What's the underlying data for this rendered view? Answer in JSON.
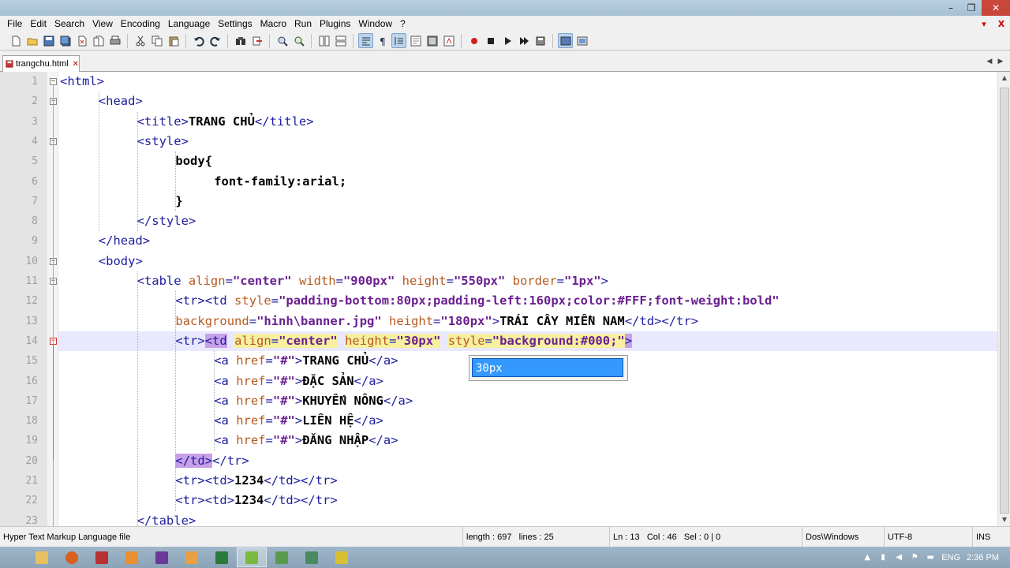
{
  "menu": [
    "File",
    "Edit",
    "Search",
    "View",
    "Encoding",
    "Language",
    "Settings",
    "Macro",
    "Run",
    "Plugins",
    "Window",
    "?"
  ],
  "menu_right": {
    "minimize": "▾",
    "close": "X"
  },
  "window_controls": {
    "minimize": "–",
    "restore": "❐",
    "close": "✕"
  },
  "tab": {
    "label": "trangchu.html",
    "close": "✕"
  },
  "line_numbers": [
    "1",
    "2",
    "3",
    "4",
    "5",
    "6",
    "7",
    "8",
    "9",
    "10",
    "11",
    "12",
    "13",
    "14",
    "15",
    "16",
    "17",
    "18",
    "19",
    "20",
    "21",
    "22",
    "23"
  ],
  "code": [
    {
      "segments": [
        {
          "c": "t",
          "s": "<html>"
        }
      ]
    },
    {
      "segments": [
        {
          "c": "t",
          "s": "<head>"
        }
      ]
    },
    {
      "segments": [
        {
          "c": "t",
          "s": "<title>"
        },
        {
          "c": "x",
          "s": "TRANG CHỦ"
        },
        {
          "c": "t",
          "s": "</title>"
        }
      ]
    },
    {
      "segments": [
        {
          "c": "t",
          "s": "<style>"
        }
      ]
    },
    {
      "segments": [
        {
          "c": "x",
          "s": "body{"
        }
      ]
    },
    {
      "segments": [
        {
          "c": "x",
          "s": "font-family:arial;"
        }
      ]
    },
    {
      "segments": [
        {
          "c": "x",
          "s": "}"
        }
      ]
    },
    {
      "segments": [
        {
          "c": "t",
          "s": "</style>"
        }
      ]
    },
    {
      "segments": [
        {
          "c": "t",
          "s": "</head>"
        }
      ]
    },
    {
      "segments": [
        {
          "c": "t",
          "s": "<body>"
        }
      ]
    },
    {
      "segments": [
        {
          "c": "t",
          "s": "<table "
        },
        {
          "c": "a",
          "s": "align"
        },
        {
          "c": "t",
          "s": "="
        },
        {
          "c": "v",
          "s": "\"center\""
        },
        {
          "c": "t",
          "s": " "
        },
        {
          "c": "a",
          "s": "width"
        },
        {
          "c": "t",
          "s": "="
        },
        {
          "c": "v",
          "s": "\"900px\""
        },
        {
          "c": "t",
          "s": " "
        },
        {
          "c": "a",
          "s": "height"
        },
        {
          "c": "t",
          "s": "="
        },
        {
          "c": "v",
          "s": "\"550px\""
        },
        {
          "c": "t",
          "s": " "
        },
        {
          "c": "a",
          "s": "border"
        },
        {
          "c": "t",
          "s": "="
        },
        {
          "c": "v",
          "s": "\"1px\""
        },
        {
          "c": "t",
          "s": ">"
        }
      ]
    },
    {
      "segments": [
        {
          "c": "t",
          "s": "<tr><td "
        },
        {
          "c": "a",
          "s": "style"
        },
        {
          "c": "t",
          "s": "="
        },
        {
          "c": "v",
          "s": "\"padding-bottom:80px;padding-left:160px;color:#FFF;font-weight:bold\""
        }
      ]
    },
    {
      "segments": [
        {
          "c": "a",
          "s": "background"
        },
        {
          "c": "t",
          "s": "="
        },
        {
          "c": "v",
          "s": "\"hinh\\banner.jpg\""
        },
        {
          "c": "t",
          "s": " "
        },
        {
          "c": "a",
          "s": "height"
        },
        {
          "c": "t",
          "s": "="
        },
        {
          "c": "v",
          "s": "\"180px\""
        },
        {
          "c": "t",
          "s": ">"
        },
        {
          "c": "x",
          "s": "TRÁI CÂY MIỀN NAM"
        },
        {
          "c": "t",
          "s": "</td></tr>"
        }
      ]
    },
    {
      "segments": [
        {
          "c": "t",
          "s": "<tr>"
        },
        {
          "c": "t hl-tag",
          "s": "<td"
        },
        {
          "c": "t",
          "s": " "
        },
        {
          "c": "a hl-attr",
          "s": "align"
        },
        {
          "c": "t hl-attr",
          "s": "="
        },
        {
          "c": "v hl-attr",
          "s": "\"center\""
        },
        {
          "c": "t",
          "s": " "
        },
        {
          "c": "a hl-attr",
          "s": "height"
        },
        {
          "c": "t hl-attr",
          "s": "="
        },
        {
          "c": "v hl-attr",
          "s": "\"30px\""
        },
        {
          "c": "t",
          "s": " "
        },
        {
          "c": "a hl-attr",
          "s": "style"
        },
        {
          "c": "t hl-attr",
          "s": "="
        },
        {
          "c": "v hl-attr",
          "s": "\"background:#000;\""
        },
        {
          "c": "t hl-tag",
          "s": ">"
        }
      ]
    },
    {
      "segments": [
        {
          "c": "t",
          "s": "<a "
        },
        {
          "c": "a",
          "s": "href"
        },
        {
          "c": "t",
          "s": "="
        },
        {
          "c": "v",
          "s": "\"#\""
        },
        {
          "c": "t",
          "s": ">"
        },
        {
          "c": "x",
          "s": "TRANG CHỦ"
        },
        {
          "c": "t",
          "s": "</a>"
        }
      ]
    },
    {
      "segments": [
        {
          "c": "t",
          "s": "<a "
        },
        {
          "c": "a",
          "s": "href"
        },
        {
          "c": "t",
          "s": "="
        },
        {
          "c": "v",
          "s": "\"#\""
        },
        {
          "c": "t",
          "s": ">"
        },
        {
          "c": "x",
          "s": "ĐẶC SẢN"
        },
        {
          "c": "t",
          "s": "</a>"
        }
      ]
    },
    {
      "segments": [
        {
          "c": "t",
          "s": "<a "
        },
        {
          "c": "a",
          "s": "href"
        },
        {
          "c": "t",
          "s": "="
        },
        {
          "c": "v",
          "s": "\"#\""
        },
        {
          "c": "t",
          "s": ">"
        },
        {
          "c": "x",
          "s": "KHUYẾN NÔNG"
        },
        {
          "c": "t",
          "s": "</a>"
        }
      ]
    },
    {
      "segments": [
        {
          "c": "t",
          "s": "<a "
        },
        {
          "c": "a",
          "s": "href"
        },
        {
          "c": "t",
          "s": "="
        },
        {
          "c": "v",
          "s": "\"#\""
        },
        {
          "c": "t",
          "s": ">"
        },
        {
          "c": "x",
          "s": "LIÊN HỆ"
        },
        {
          "c": "t",
          "s": "</a>"
        }
      ]
    },
    {
      "segments": [
        {
          "c": "t",
          "s": "<a "
        },
        {
          "c": "a",
          "s": "href"
        },
        {
          "c": "t",
          "s": "="
        },
        {
          "c": "v",
          "s": "\"#\""
        },
        {
          "c": "t",
          "s": ">"
        },
        {
          "c": "x",
          "s": "ĐĂNG NHẬP"
        },
        {
          "c": "t",
          "s": "</a>"
        }
      ]
    },
    {
      "segments": [
        {
          "c": "t hl-tag",
          "s": "</td>"
        },
        {
          "c": "t",
          "s": "</tr>"
        }
      ]
    },
    {
      "segments": [
        {
          "c": "t",
          "s": "<tr><td>"
        },
        {
          "c": "x",
          "s": "1234"
        },
        {
          "c": "t",
          "s": "</td></tr>"
        }
      ]
    },
    {
      "segments": [
        {
          "c": "t",
          "s": "<tr><td>"
        },
        {
          "c": "x",
          "s": "1234"
        },
        {
          "c": "t",
          "s": "</td></tr>"
        }
      ]
    },
    {
      "segments": [
        {
          "c": "t",
          "s": "</table>"
        }
      ]
    }
  ],
  "autocomplete": {
    "item": "30px"
  },
  "status": {
    "filetype": "Hyper Text Markup Language file",
    "length": "length : 697",
    "lines": "lines : 25",
    "ln": "Ln : 13",
    "col": "Col : 46",
    "sel": "Sel : 0 | 0",
    "eol": "Dos\\Windows",
    "encoding": "UTF-8",
    "mode": "INS"
  },
  "tray": {
    "lang": "ENG",
    "time": "2:36 PM"
  }
}
